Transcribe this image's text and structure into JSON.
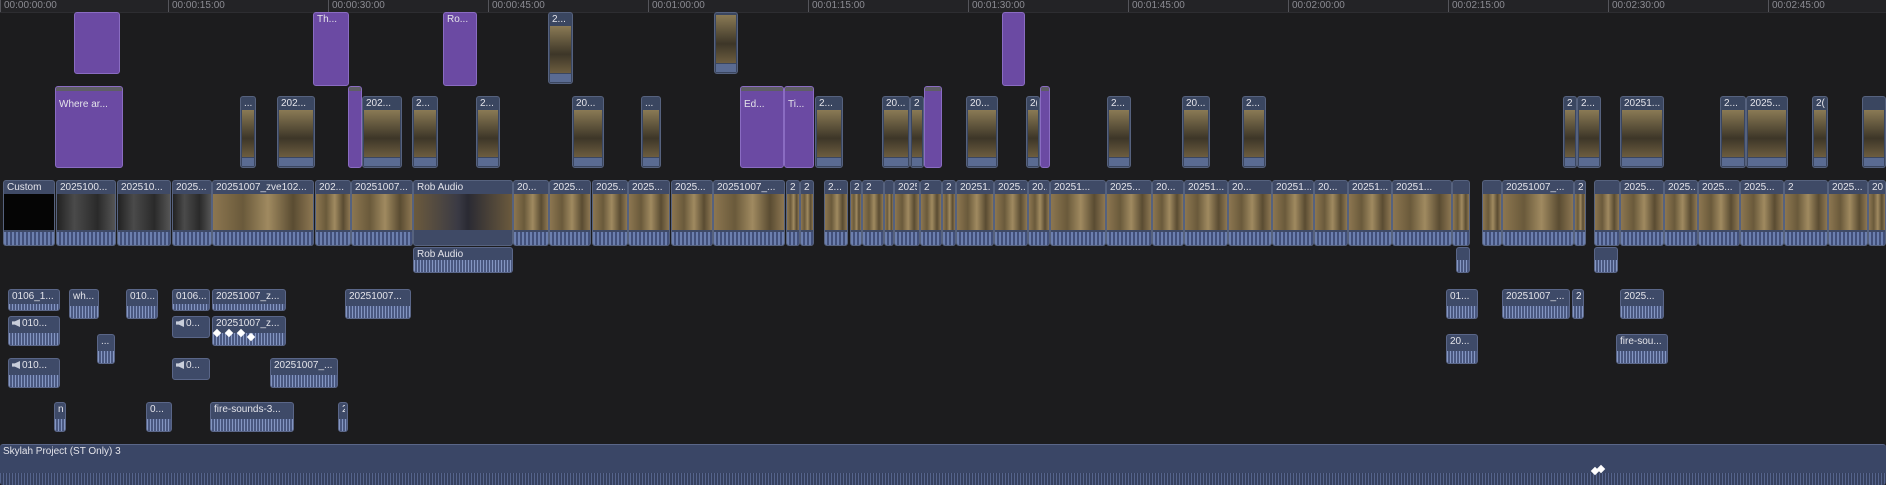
{
  "ruler": [
    "00:00:00:00",
    "00:00:15:00",
    "00:00:30:00",
    "00:00:45:00",
    "00:01:00:00",
    "00:01:15:00",
    "00:01:30:00",
    "00:01:45:00",
    "00:02:00:00",
    "00:02:15:00",
    "00:02:30:00",
    "00:02:45:00"
  ],
  "titles_top": [
    "",
    "Th...",
    "Ro...",
    "",
    ""
  ],
  "connected_top": [
    "2..."
  ],
  "titles_mid": [
    "Where ar...",
    "Ed...",
    "Ti..."
  ],
  "connected_mid": [
    "...",
    "202...",
    "202...",
    "2...",
    "2...",
    "20...",
    "...",
    "2...",
    "20...",
    "2",
    "20...",
    "2(",
    "2...",
    "20...",
    "2...",
    "2",
    "2...",
    "20251...",
    "2...",
    "2025...",
    "2("
  ],
  "primary": [
    "Custom",
    "2025100...",
    "202510...",
    "2025...",
    "20251007_zve102...",
    "202...",
    "20251007...",
    "Rob Audio",
    "20...",
    "2025...",
    "2025...",
    "2025...",
    "2025...",
    "20251007_...",
    "2",
    "2",
    "2...",
    "2",
    "2",
    "20251007...",
    "2",
    "2",
    "20251...",
    "2025...",
    "20...",
    "20251...",
    "2025...",
    "20...",
    "20251...",
    "20...",
    "20251...",
    "20251007_...",
    "2",
    "2025...",
    "2025...",
    "2",
    "2025...",
    "2025..."
  ],
  "primary_audio": [
    "Rob Audio"
  ],
  "audio_lane1": [
    "0106_1...",
    "wh...",
    "010...",
    "0106...",
    "20251007_z...",
    "20251007...",
    "01...",
    "20251007_...",
    "2",
    "2025..."
  ],
  "audio_lane2": [
    "010...",
    "0...",
    "20251007_z...",
    "..."
  ],
  "audio_lane3": [
    "010...",
    "0...",
    "20251007_...",
    "20...",
    "fire-sou..."
  ],
  "audio_lane4": [
    "no",
    "0...",
    "fire-sounds-3...",
    "2"
  ],
  "stem": {
    "label": "Skylah Project (ST Only) 3"
  },
  "colors": {
    "title": "#6b4aa3",
    "clip": "#3f4a66",
    "waveform": "#6c7fae",
    "background": "#1c1c1e"
  }
}
